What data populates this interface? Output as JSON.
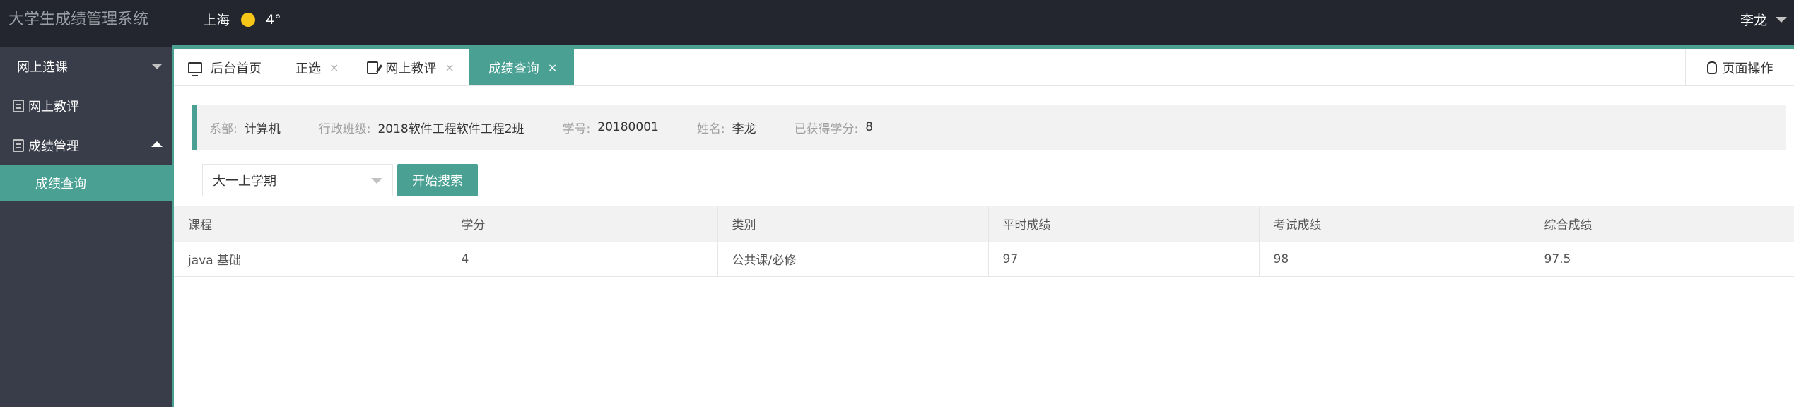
{
  "header": {
    "brand": "大学生成绩管理系统",
    "city": "上海",
    "temperature": "4°",
    "user_name": "李龙"
  },
  "sidebar": {
    "items": [
      {
        "label": "网上选课"
      },
      {
        "label": "网上教评"
      },
      {
        "label": "成绩管理"
      }
    ],
    "active_child": "成绩查询"
  },
  "tabs": [
    {
      "label": "后台首页"
    },
    {
      "label": "正选",
      "close": "×"
    },
    {
      "label": "网上教评",
      "close": "×"
    },
    {
      "label": "成绩查询",
      "close": "×"
    }
  ],
  "page_ops_label": "页面操作",
  "student_info": {
    "dept_label": "系部:",
    "dept_value": "计算机",
    "class_label": "行政班级:",
    "class_value": "2018软件工程软件工程2班",
    "id_label": "学号:",
    "id_value": "20180001",
    "name_label": "姓名:",
    "name_value": "李龙",
    "credits_label": "已获得学分:",
    "credits_value": "8"
  },
  "filter": {
    "semester_selected": "大一上学期",
    "search_label": "开始搜索"
  },
  "table": {
    "headers": [
      "课程",
      "学分",
      "类别",
      "平时成绩",
      "考试成绩",
      "综合成绩"
    ],
    "rows": [
      [
        "java 基础",
        "4",
        "公共课/必修",
        "97",
        "98",
        "97.5"
      ]
    ]
  },
  "colors": {
    "accent": "#4aa193",
    "topbar": "#23262e",
    "sidebar": "#393d49"
  }
}
